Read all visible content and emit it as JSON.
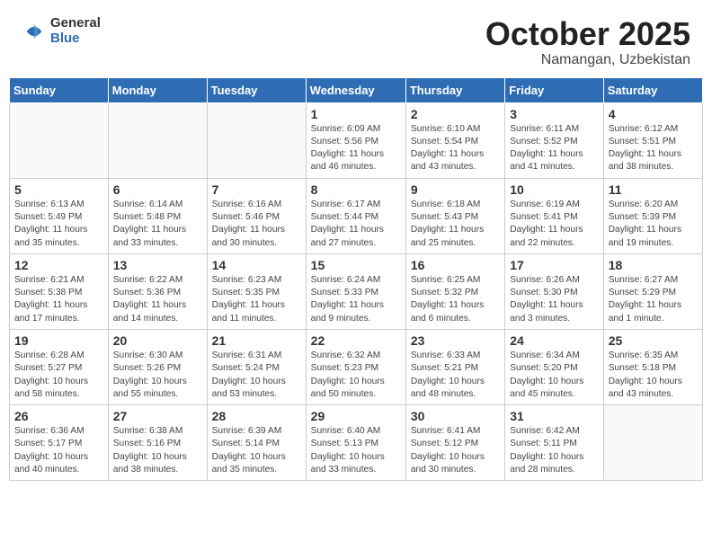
{
  "header": {
    "logo_general": "General",
    "logo_blue": "Blue",
    "title": "October 2025",
    "location": "Namangan, Uzbekistan"
  },
  "weekdays": [
    "Sunday",
    "Monday",
    "Tuesday",
    "Wednesday",
    "Thursday",
    "Friday",
    "Saturday"
  ],
  "weeks": [
    [
      {
        "day": "",
        "info": ""
      },
      {
        "day": "",
        "info": ""
      },
      {
        "day": "",
        "info": ""
      },
      {
        "day": "1",
        "info": "Sunrise: 6:09 AM\nSunset: 5:56 PM\nDaylight: 11 hours\nand 46 minutes."
      },
      {
        "day": "2",
        "info": "Sunrise: 6:10 AM\nSunset: 5:54 PM\nDaylight: 11 hours\nand 43 minutes."
      },
      {
        "day": "3",
        "info": "Sunrise: 6:11 AM\nSunset: 5:52 PM\nDaylight: 11 hours\nand 41 minutes."
      },
      {
        "day": "4",
        "info": "Sunrise: 6:12 AM\nSunset: 5:51 PM\nDaylight: 11 hours\nand 38 minutes."
      }
    ],
    [
      {
        "day": "5",
        "info": "Sunrise: 6:13 AM\nSunset: 5:49 PM\nDaylight: 11 hours\nand 35 minutes."
      },
      {
        "day": "6",
        "info": "Sunrise: 6:14 AM\nSunset: 5:48 PM\nDaylight: 11 hours\nand 33 minutes."
      },
      {
        "day": "7",
        "info": "Sunrise: 6:16 AM\nSunset: 5:46 PM\nDaylight: 11 hours\nand 30 minutes."
      },
      {
        "day": "8",
        "info": "Sunrise: 6:17 AM\nSunset: 5:44 PM\nDaylight: 11 hours\nand 27 minutes."
      },
      {
        "day": "9",
        "info": "Sunrise: 6:18 AM\nSunset: 5:43 PM\nDaylight: 11 hours\nand 25 minutes."
      },
      {
        "day": "10",
        "info": "Sunrise: 6:19 AM\nSunset: 5:41 PM\nDaylight: 11 hours\nand 22 minutes."
      },
      {
        "day": "11",
        "info": "Sunrise: 6:20 AM\nSunset: 5:39 PM\nDaylight: 11 hours\nand 19 minutes."
      }
    ],
    [
      {
        "day": "12",
        "info": "Sunrise: 6:21 AM\nSunset: 5:38 PM\nDaylight: 11 hours\nand 17 minutes."
      },
      {
        "day": "13",
        "info": "Sunrise: 6:22 AM\nSunset: 5:36 PM\nDaylight: 11 hours\nand 14 minutes."
      },
      {
        "day": "14",
        "info": "Sunrise: 6:23 AM\nSunset: 5:35 PM\nDaylight: 11 hours\nand 11 minutes."
      },
      {
        "day": "15",
        "info": "Sunrise: 6:24 AM\nSunset: 5:33 PM\nDaylight: 11 hours\nand 9 minutes."
      },
      {
        "day": "16",
        "info": "Sunrise: 6:25 AM\nSunset: 5:32 PM\nDaylight: 11 hours\nand 6 minutes."
      },
      {
        "day": "17",
        "info": "Sunrise: 6:26 AM\nSunset: 5:30 PM\nDaylight: 11 hours\nand 3 minutes."
      },
      {
        "day": "18",
        "info": "Sunrise: 6:27 AM\nSunset: 5:29 PM\nDaylight: 11 hours\nand 1 minute."
      }
    ],
    [
      {
        "day": "19",
        "info": "Sunrise: 6:28 AM\nSunset: 5:27 PM\nDaylight: 10 hours\nand 58 minutes."
      },
      {
        "day": "20",
        "info": "Sunrise: 6:30 AM\nSunset: 5:26 PM\nDaylight: 10 hours\nand 55 minutes."
      },
      {
        "day": "21",
        "info": "Sunrise: 6:31 AM\nSunset: 5:24 PM\nDaylight: 10 hours\nand 53 minutes."
      },
      {
        "day": "22",
        "info": "Sunrise: 6:32 AM\nSunset: 5:23 PM\nDaylight: 10 hours\nand 50 minutes."
      },
      {
        "day": "23",
        "info": "Sunrise: 6:33 AM\nSunset: 5:21 PM\nDaylight: 10 hours\nand 48 minutes."
      },
      {
        "day": "24",
        "info": "Sunrise: 6:34 AM\nSunset: 5:20 PM\nDaylight: 10 hours\nand 45 minutes."
      },
      {
        "day": "25",
        "info": "Sunrise: 6:35 AM\nSunset: 5:18 PM\nDaylight: 10 hours\nand 43 minutes."
      }
    ],
    [
      {
        "day": "26",
        "info": "Sunrise: 6:36 AM\nSunset: 5:17 PM\nDaylight: 10 hours\nand 40 minutes."
      },
      {
        "day": "27",
        "info": "Sunrise: 6:38 AM\nSunset: 5:16 PM\nDaylight: 10 hours\nand 38 minutes."
      },
      {
        "day": "28",
        "info": "Sunrise: 6:39 AM\nSunset: 5:14 PM\nDaylight: 10 hours\nand 35 minutes."
      },
      {
        "day": "29",
        "info": "Sunrise: 6:40 AM\nSunset: 5:13 PM\nDaylight: 10 hours\nand 33 minutes."
      },
      {
        "day": "30",
        "info": "Sunrise: 6:41 AM\nSunset: 5:12 PM\nDaylight: 10 hours\nand 30 minutes."
      },
      {
        "day": "31",
        "info": "Sunrise: 6:42 AM\nSunset: 5:11 PM\nDaylight: 10 hours\nand 28 minutes."
      },
      {
        "day": "",
        "info": ""
      }
    ]
  ]
}
